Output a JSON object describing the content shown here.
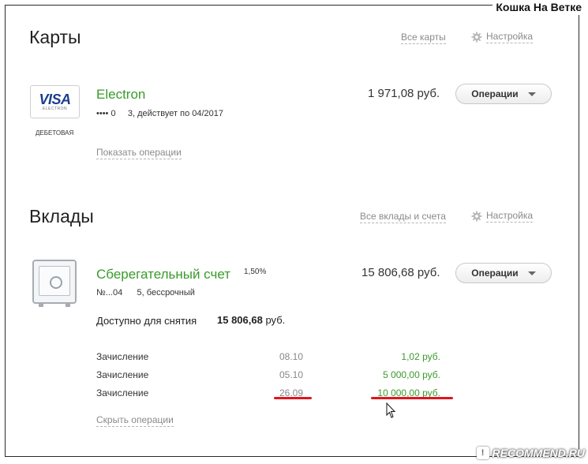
{
  "watermark_top": "Кошка На Ветке",
  "watermark_bottom": "RECOMMEND.RU",
  "watermark_badge": "!",
  "cards": {
    "title": "Карты",
    "all_link": "Все карты",
    "settings_label": "Настройка",
    "card": {
      "logo_brand": "VISA",
      "logo_sub": "ELECTRON",
      "type": "ДЕБЕТОВАЯ",
      "name": "Electron",
      "details": "•••• 0     3, действует по 04/2017",
      "amount": "1 971,08 руб.",
      "ops_button": "Операции",
      "show_ops": "Показать операции"
    }
  },
  "deposits": {
    "title": "Вклады",
    "all_link": "Все вклады и счета",
    "settings_label": "Настройка",
    "account": {
      "name": "Сберегательный счет",
      "rate": "1,50%",
      "details": "№...04      5, бессрочный",
      "amount": "15 806,68 руб.",
      "ops_button": "Операции",
      "available_label": "Доступно для снятия",
      "available_value": "15 806,68",
      "available_unit": "руб.",
      "transactions": [
        {
          "label": "Зачисление",
          "date": "08.10",
          "amount": "1,02 руб."
        },
        {
          "label": "Зачисление",
          "date": "05.10",
          "amount": "5 000,00 руб."
        },
        {
          "label": "Зачисление",
          "date": "26.09",
          "amount": "10 000,00 руб."
        }
      ],
      "hide_ops": "Скрыть операции"
    }
  },
  "colors": {
    "accent_green": "#3a9a2c",
    "highlight_red": "#e0151d",
    "visa_blue": "#1a3d8f"
  }
}
